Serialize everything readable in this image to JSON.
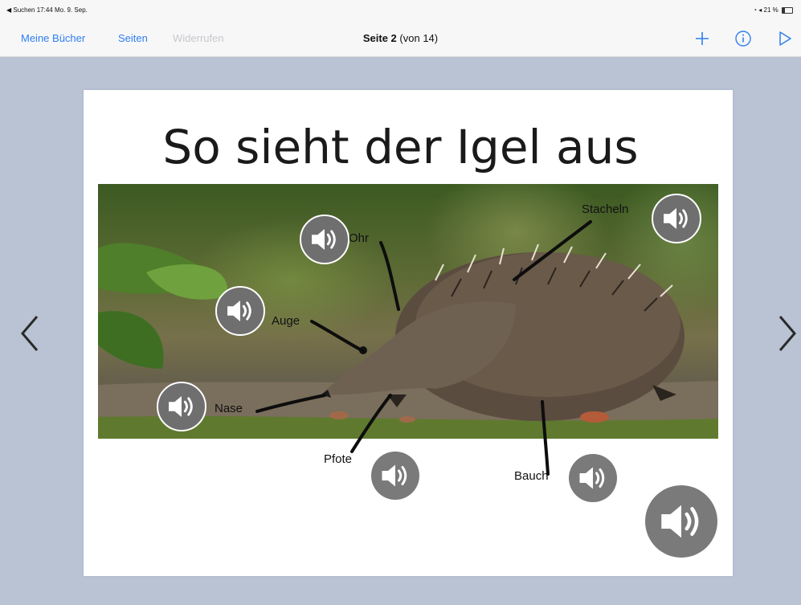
{
  "status_bar": {
    "left": "◀ Suchen   17:44   Mo. 9. Sep.",
    "right": "21 %"
  },
  "toolbar": {
    "my_books": "Meine Bücher",
    "pages": "Seiten",
    "undo": "Widerrufen",
    "page_label": "Seite 2",
    "page_of": "(von 14)"
  },
  "page": {
    "title": "So sieht der Igel aus",
    "labels": {
      "stacheln": "Stacheln",
      "ohr": "Ohr",
      "auge": "Auge",
      "nase": "Nase",
      "pfote": "Pfote",
      "bauch": "Bauch"
    }
  },
  "colors": {
    "accent": "#2f7ef0",
    "background": "#b9c3d4",
    "sound_button": "#6f6f6f"
  },
  "icons": [
    "plus-icon",
    "info-icon",
    "play-icon",
    "chevron-left-icon",
    "chevron-right-icon",
    "speaker-icon"
  ]
}
